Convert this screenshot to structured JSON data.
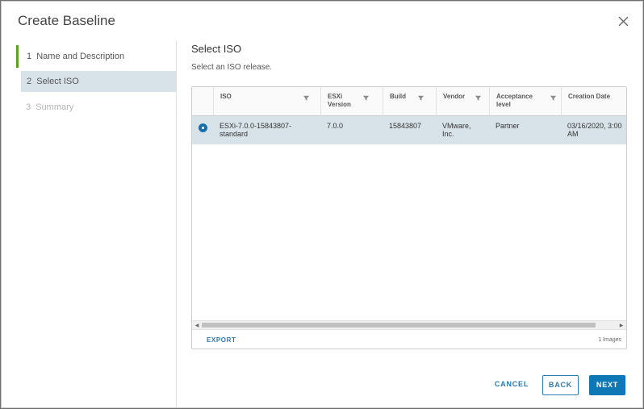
{
  "dialog": {
    "title": "Create Baseline"
  },
  "steps": [
    {
      "label": "1  Name and Description"
    },
    {
      "label": "2  Select ISO"
    },
    {
      "label": "3  Summary"
    }
  ],
  "content": {
    "title": "Select ISO",
    "subtitle": "Select an ISO release."
  },
  "grid": {
    "columns": [
      "ISO",
      "ESXi\nVersion",
      "Build",
      "Vendor",
      "Acceptance\nlevel",
      "Creation Date"
    ],
    "rows": [
      {
        "iso": "ESXi-7.0.0-15843807-\nstandard",
        "version": "7.0.0",
        "build": "15843807",
        "vendor": "VMware,\nInc.",
        "acceptance": "Partner",
        "creation_date": "03/16/2020, 3:00\nAM",
        "selected": true
      }
    ],
    "export_label": "EXPORT",
    "count_label": "1 Images"
  },
  "buttons": {
    "cancel": "CANCEL",
    "back": "BACK",
    "next": "NEXT"
  },
  "colors": {
    "accent": "#0e78b6",
    "step_complete": "#5aa220",
    "selection": "#d8e3e9"
  },
  "icons": {
    "close": "close-icon",
    "filter": "filter-icon",
    "radio": "radio-selected-icon"
  }
}
